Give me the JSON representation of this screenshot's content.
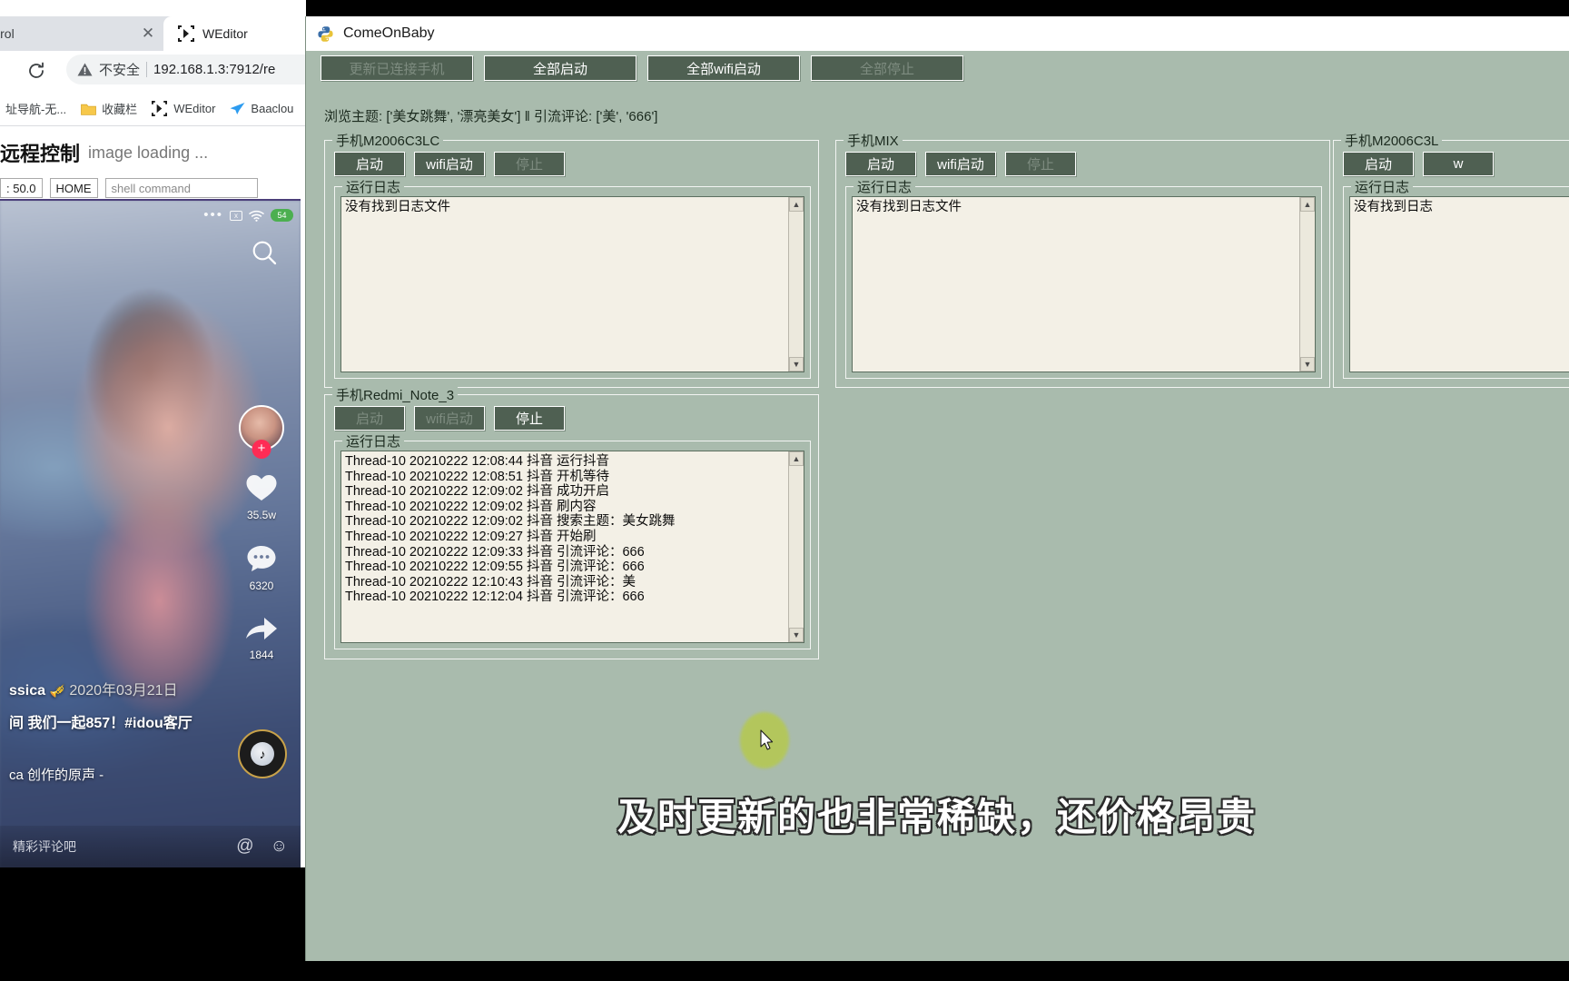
{
  "browser": {
    "tab_inactive_label": "e control",
    "tab_active_label": "WEditor",
    "reload_icon": "reload-icon",
    "security_label": "不安全",
    "warning_icon": "warning-triangle-icon",
    "url": "192.168.1.3:7912/re",
    "bookmarks": [
      {
        "label": "址导航-无...",
        "icon": ""
      },
      {
        "label": "收藏栏",
        "icon": "folder-icon"
      },
      {
        "label": "WEditor",
        "icon": "weditor-icon"
      },
      {
        "label": "Baaclou",
        "icon": "paper-plane-icon"
      }
    ],
    "page": {
      "title": "远程控制",
      "status": "image loading ...",
      "controls": [
        {
          "name": "scale-value",
          "value": ": 50.0"
        },
        {
          "name": "home-button",
          "value": "HOME"
        },
        {
          "name": "shell-input",
          "placeholder": "shell command"
        }
      ]
    }
  },
  "phone_mirror": {
    "status_bar": {
      "dots_icon": "more-dots-icon",
      "x_box_icon": "x-box-icon",
      "wifi_icon": "wifi-icon",
      "battery": "54"
    },
    "search_icon": "search-icon",
    "avatar_icon": "avatar",
    "follow_icon": "plus-follow-icon",
    "like": {
      "icon": "heart-icon",
      "count": "35.5w"
    },
    "comment": {
      "icon": "comment-icon",
      "count": "6320"
    },
    "share": {
      "icon": "share-arrow-icon",
      "count": "1844"
    },
    "disc_icon": "music-disc-icon",
    "username": "ssica",
    "date": "2020年03月21日",
    "description": "间 我们一起857！#idou客厅",
    "music": "ca 创作的原声 -",
    "comment_placeholder": "精彩评论吧",
    "at_icon": "at-icon",
    "emoji_icon": "emoji-icon"
  },
  "app": {
    "title": "ComeOnBaby",
    "app_icon": "python-icon",
    "toolbar": [
      {
        "label": "更新已连接手机",
        "disabled": true
      },
      {
        "label": "全部启动",
        "disabled": false
      },
      {
        "label": "全部wifi启动",
        "disabled": false
      },
      {
        "label": "全部停止",
        "disabled": true
      }
    ],
    "summary": "浏览主题: ['美女跳舞', '漂亮美女']   ‖  引流评论: ['美', '666']",
    "log_group_label": "运行日志",
    "empty_log": "没有找到日志文件",
    "devices": [
      {
        "name": "手机M2006C3LC",
        "buttons": [
          {
            "label": "启动",
            "disabled": false
          },
          {
            "label": "wifi启动",
            "disabled": false
          },
          {
            "label": "停止",
            "disabled": true
          }
        ],
        "log_lines": [
          "没有找到日志文件"
        ]
      },
      {
        "name": "手机MIX",
        "buttons": [
          {
            "label": "启动",
            "disabled": false
          },
          {
            "label": "wifi启动",
            "disabled": false
          },
          {
            "label": "停止",
            "disabled": true
          }
        ],
        "log_lines": [
          "没有找到日志文件"
        ]
      },
      {
        "name": "手机M2006C3L",
        "buttons": [
          {
            "label": "启动",
            "disabled": false
          },
          {
            "label": "w",
            "disabled": false
          }
        ],
        "log_lines": [
          "没有找到日志"
        ]
      },
      {
        "name": "手机Redmi_Note_3",
        "buttons": [
          {
            "label": "启动",
            "disabled": true
          },
          {
            "label": "wifi启动",
            "disabled": true
          },
          {
            "label": "停止",
            "disabled": false
          }
        ],
        "log_lines": [
          "Thread-10 20210222 12:08:44 抖音 运行抖音",
          "Thread-10 20210222 12:08:51 抖音 开机等待",
          "Thread-10 20210222 12:09:02 抖音 成功开启",
          "Thread-10 20210222 12:09:02 抖音 刷内容",
          "Thread-10 20210222 12:09:02 抖音 搜索主题：美女跳舞",
          "Thread-10 20210222 12:09:27 抖音 开始刷",
          "Thread-10 20210222 12:09:33 抖音 引流评论：666",
          "Thread-10 20210222 12:09:55 抖音 引流评论：666",
          "Thread-10 20210222 12:10:43 抖音 引流评论：美",
          "Thread-10 20210222 12:12:04 抖音 引流评论：666"
        ]
      }
    ],
    "scroll_up_icon": "scroll-up-arrow-icon",
    "scroll_down_icon": "scroll-down-arrow-icon"
  },
  "subtitle": "及时更新的也非常稀缺，还价格昂贵",
  "cursor": {
    "icon": "mouse-cursor-icon",
    "highlight_color": "#b5c94f"
  }
}
